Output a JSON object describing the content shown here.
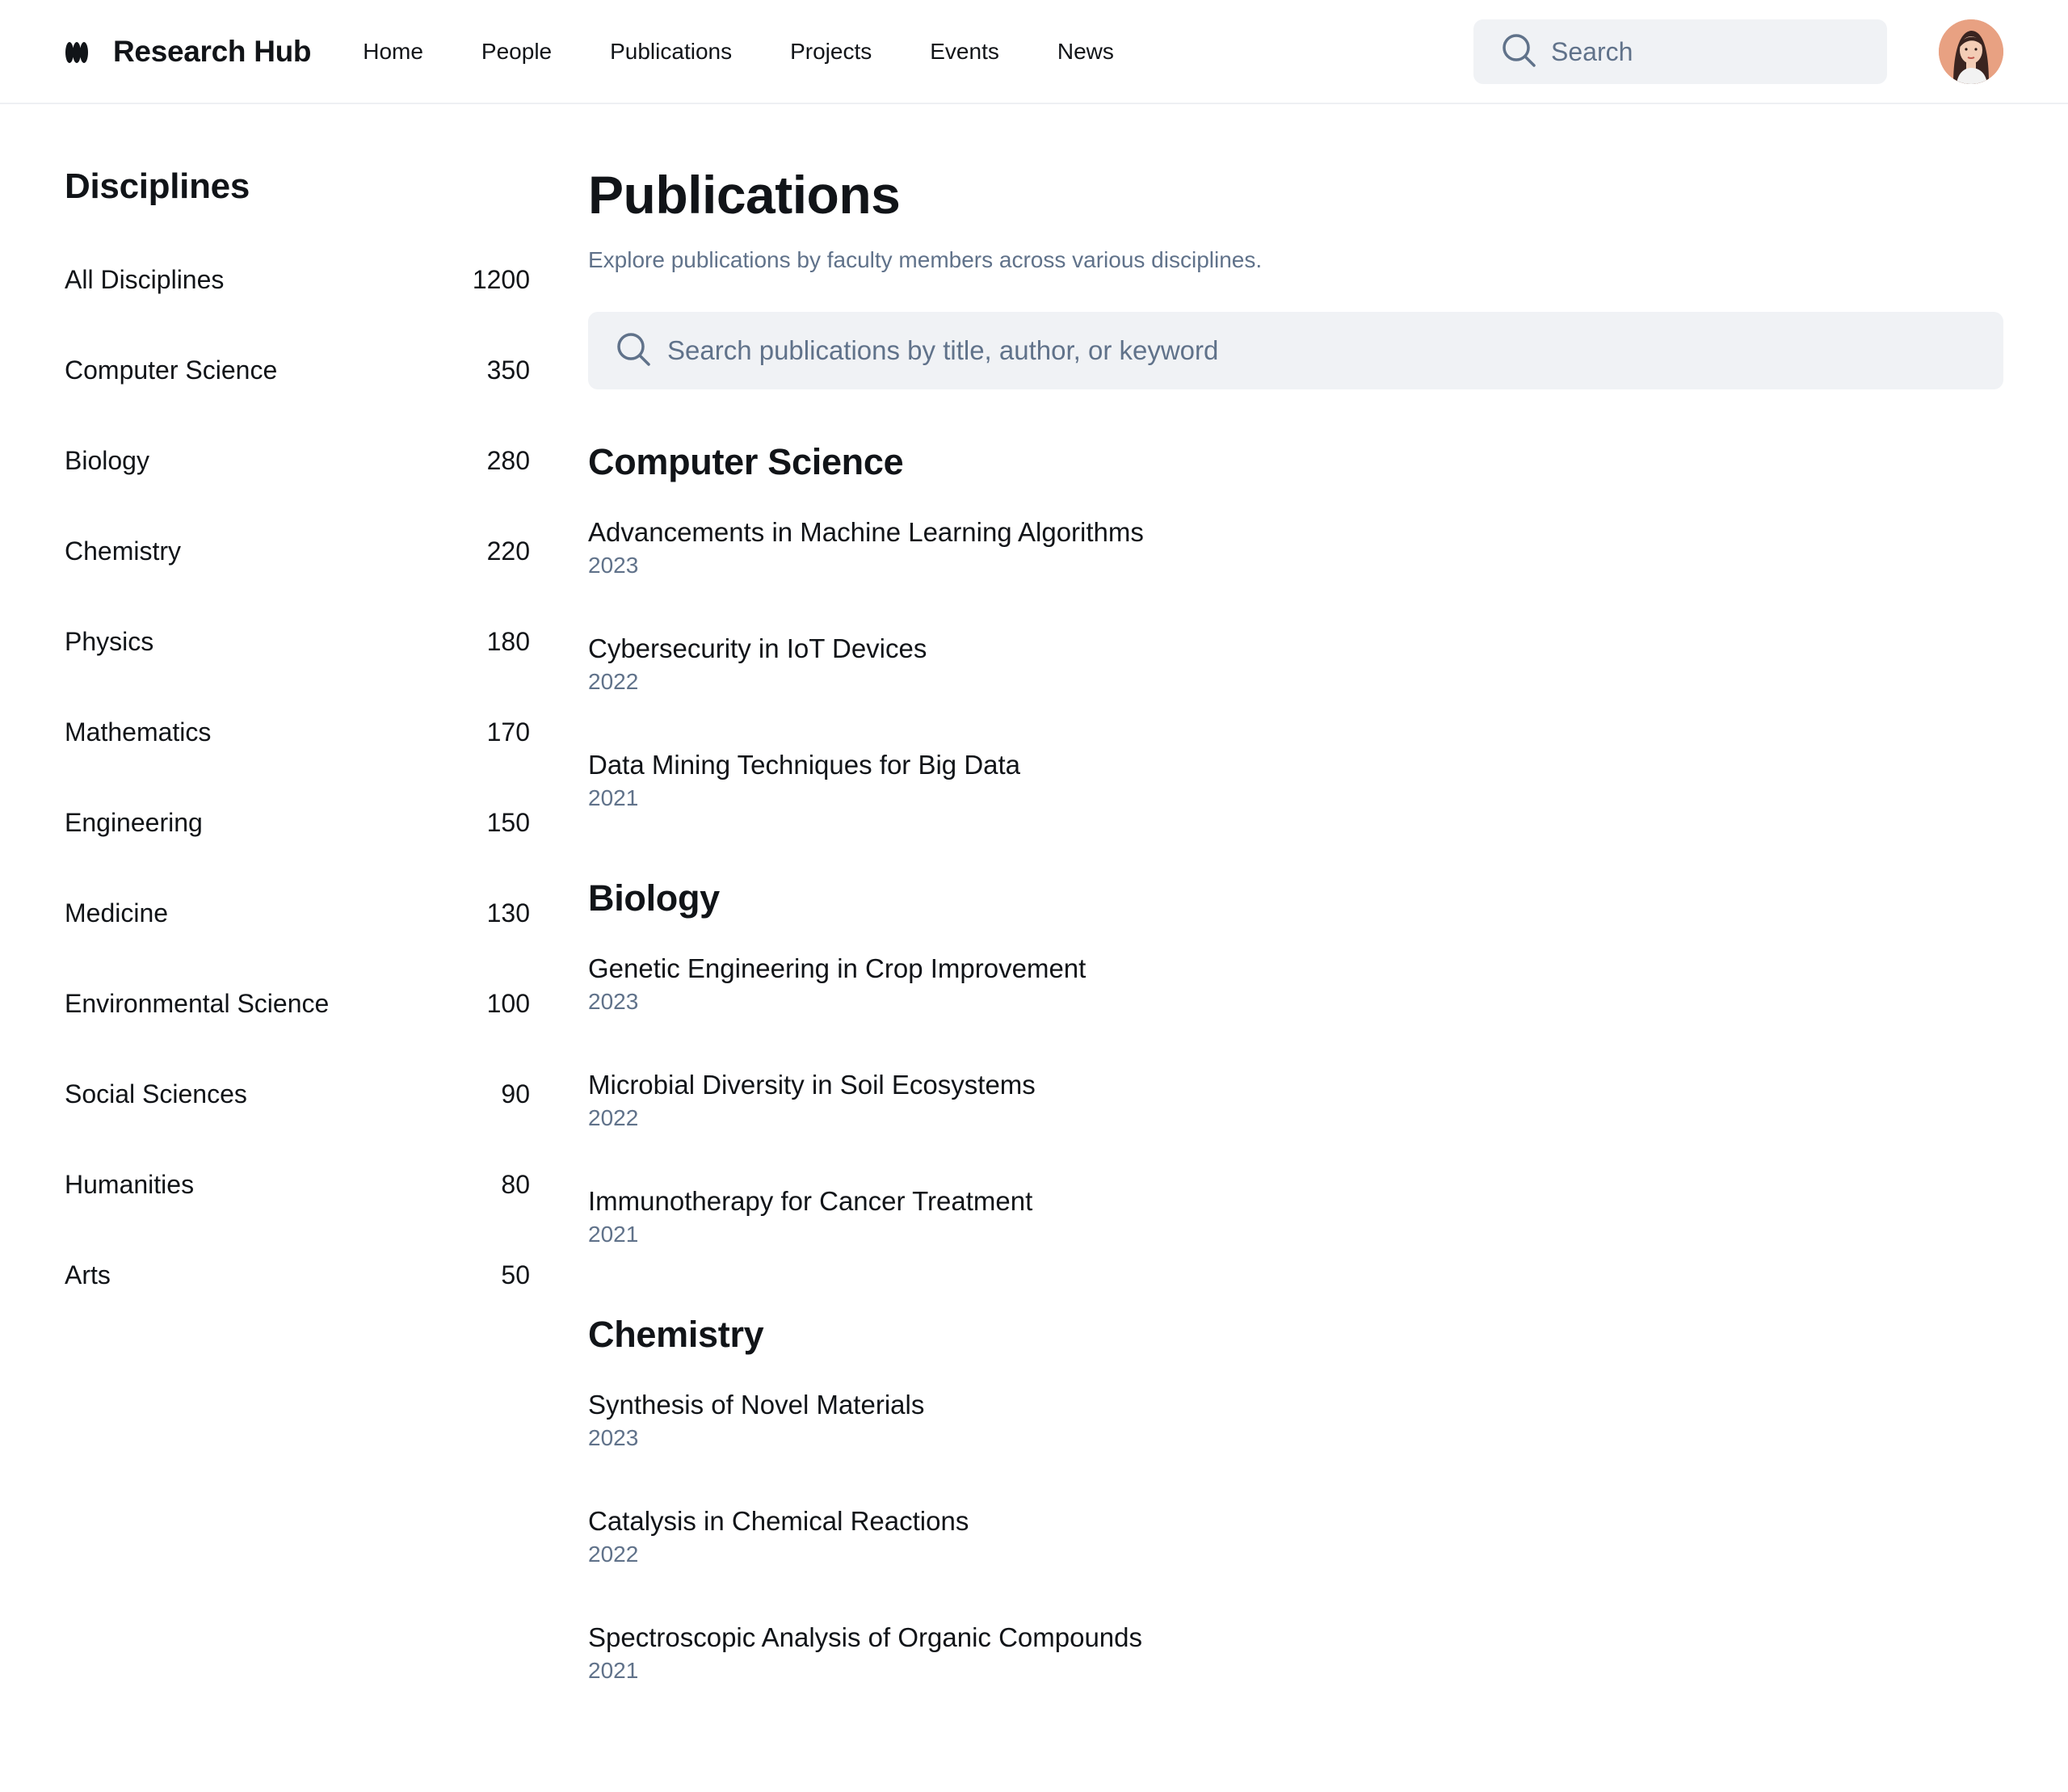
{
  "header": {
    "logo_text": "Research Hub",
    "nav": [
      "Home",
      "People",
      "Publications",
      "Projects",
      "Events",
      "News"
    ],
    "search_placeholder": "Search"
  },
  "sidebar": {
    "title": "Disciplines",
    "items": [
      {
        "label": "All Disciplines",
        "count": "1200"
      },
      {
        "label": "Computer Science",
        "count": "350"
      },
      {
        "label": "Biology",
        "count": "280"
      },
      {
        "label": "Chemistry",
        "count": "220"
      },
      {
        "label": "Physics",
        "count": "180"
      },
      {
        "label": "Mathematics",
        "count": "170"
      },
      {
        "label": "Engineering",
        "count": "150"
      },
      {
        "label": "Medicine",
        "count": "130"
      },
      {
        "label": "Environmental Science",
        "count": "100"
      },
      {
        "label": "Social Sciences",
        "count": "90"
      },
      {
        "label": "Humanities",
        "count": "80"
      },
      {
        "label": "Arts",
        "count": "50"
      }
    ]
  },
  "main": {
    "title": "Publications",
    "subtitle": "Explore publications by faculty members across various disciplines.",
    "search_placeholder": "Search publications by title, author, or keyword",
    "sections": [
      {
        "title": "Computer Science",
        "publications": [
          {
            "title": "Advancements in Machine Learning Algorithms",
            "year": "2023"
          },
          {
            "title": "Cybersecurity in IoT Devices",
            "year": "2022"
          },
          {
            "title": "Data Mining Techniques for Big Data",
            "year": "2021"
          }
        ]
      },
      {
        "title": "Biology",
        "publications": [
          {
            "title": "Genetic Engineering in Crop Improvement",
            "year": "2023"
          },
          {
            "title": "Microbial Diversity in Soil Ecosystems",
            "year": "2022"
          },
          {
            "title": "Immunotherapy for Cancer Treatment",
            "year": "2021"
          }
        ]
      },
      {
        "title": "Chemistry",
        "publications": [
          {
            "title": "Synthesis of Novel Materials",
            "year": "2023"
          },
          {
            "title": "Catalysis in Chemical Reactions",
            "year": "2022"
          },
          {
            "title": "Spectroscopic Analysis of Organic Compounds",
            "year": "2021"
          }
        ]
      }
    ]
  },
  "colors": {
    "text": "#111418",
    "muted": "#60728a",
    "search_bg": "#f0f2f5",
    "avatar_bg": "#e8a182"
  },
  "icons": [
    "logo-mark-icon",
    "search-icon",
    "avatar"
  ]
}
